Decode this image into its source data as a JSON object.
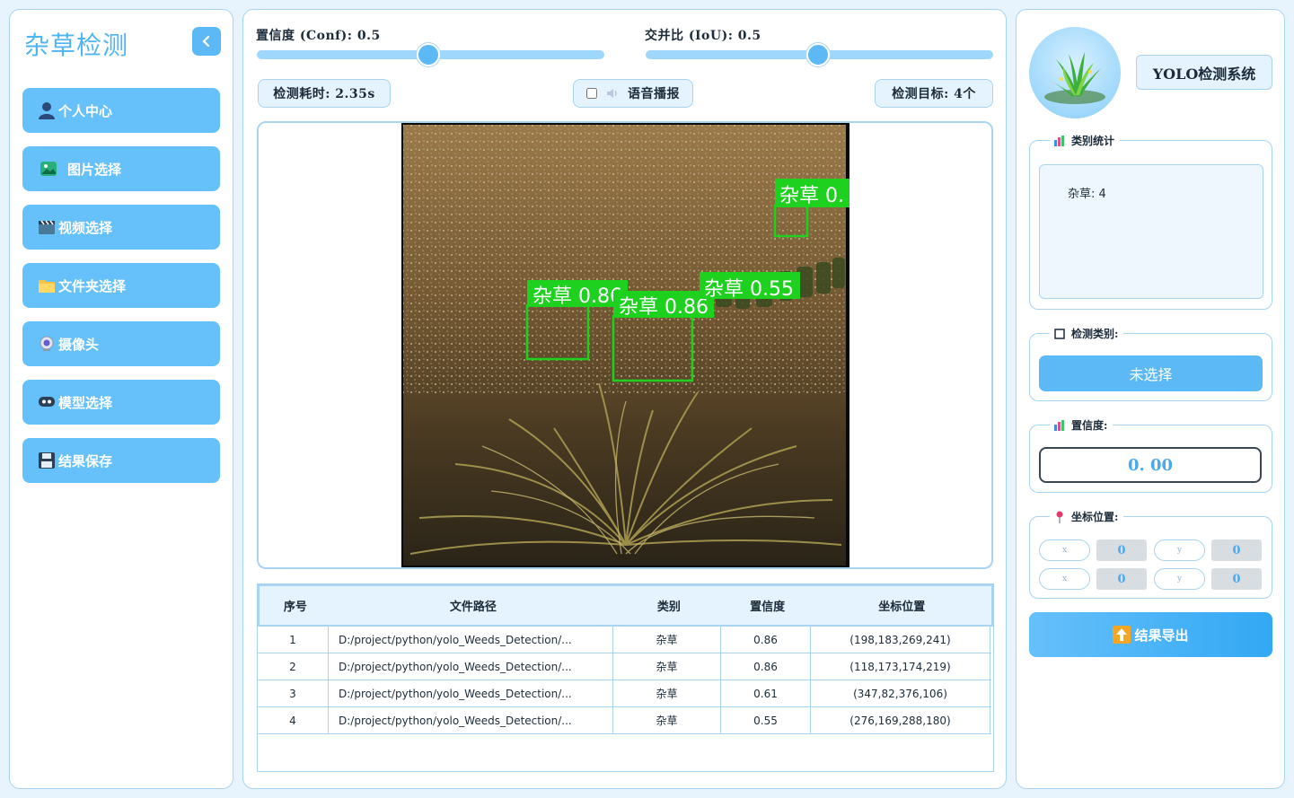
{
  "sidebar": {
    "title": "杂草检测",
    "items": [
      {
        "label": "个人中心",
        "icon": "user-icon"
      },
      {
        "label": "图片选择",
        "icon": "image-icon"
      },
      {
        "label": "视频选择",
        "icon": "clapperboard-icon"
      },
      {
        "label": "文件夹选择",
        "icon": "folder-icon"
      },
      {
        "label": "摄像头",
        "icon": "webcam-icon"
      },
      {
        "label": "模型选择",
        "icon": "model-icon"
      },
      {
        "label": "结果保存",
        "icon": "floppy-disk-icon"
      }
    ]
  },
  "controls": {
    "conf_label": "置信度 (Conf): 0.5",
    "conf_value": 0.5,
    "iou_label": "交并比 (IoU): 0.5",
    "iou_value": 0.5,
    "time_label": "检测耗时: 2.35s",
    "voice_label": "语音播报",
    "voice_checked": false,
    "targets_label": "检测目标: 4个"
  },
  "detections": [
    {
      "label": "杂草 0.86"
    },
    {
      "label": "杂草 0.86"
    },
    {
      "label": "杂草 0.55"
    },
    {
      "label": "杂草 0."
    }
  ],
  "table": {
    "headers": [
      "序号",
      "文件路径",
      "类别",
      "置信度",
      "坐标位置"
    ],
    "rows": [
      [
        "1",
        "D:/project/python/yolo_Weeds_Detection/...",
        "杂草",
        "0.86",
        "(198,183,269,241)"
      ],
      [
        "2",
        "D:/project/python/yolo_Weeds_Detection/...",
        "杂草",
        "0.86",
        "(118,173,174,219)"
      ],
      [
        "3",
        "D:/project/python/yolo_Weeds_Detection/...",
        "杂草",
        "0.61",
        "(347,82,376,106)"
      ],
      [
        "4",
        "D:/project/python/yolo_Weeds_Detection/...",
        "杂草",
        "0.55",
        "(276,169,288,180)"
      ]
    ]
  },
  "right": {
    "system_title": "YOLO检测系统",
    "stats_legend": "类别统计",
    "stats_text": "杂草: 4",
    "class_legend": "检测类别:",
    "class_value": "未选择",
    "conf_legend": "置信度:",
    "conf_value": "0. 00",
    "coord_legend": "坐标位置:",
    "coords": [
      {
        "label": "x",
        "value": "0"
      },
      {
        "label": "y",
        "value": "0"
      },
      {
        "label": "x",
        "value": "0"
      },
      {
        "label": "y",
        "value": "0"
      }
    ],
    "export_label": "结果导出"
  },
  "colors": {
    "accent": "#5cb9f5",
    "panel_border": "#a8d4f2",
    "box_green": "#1fd11f"
  }
}
